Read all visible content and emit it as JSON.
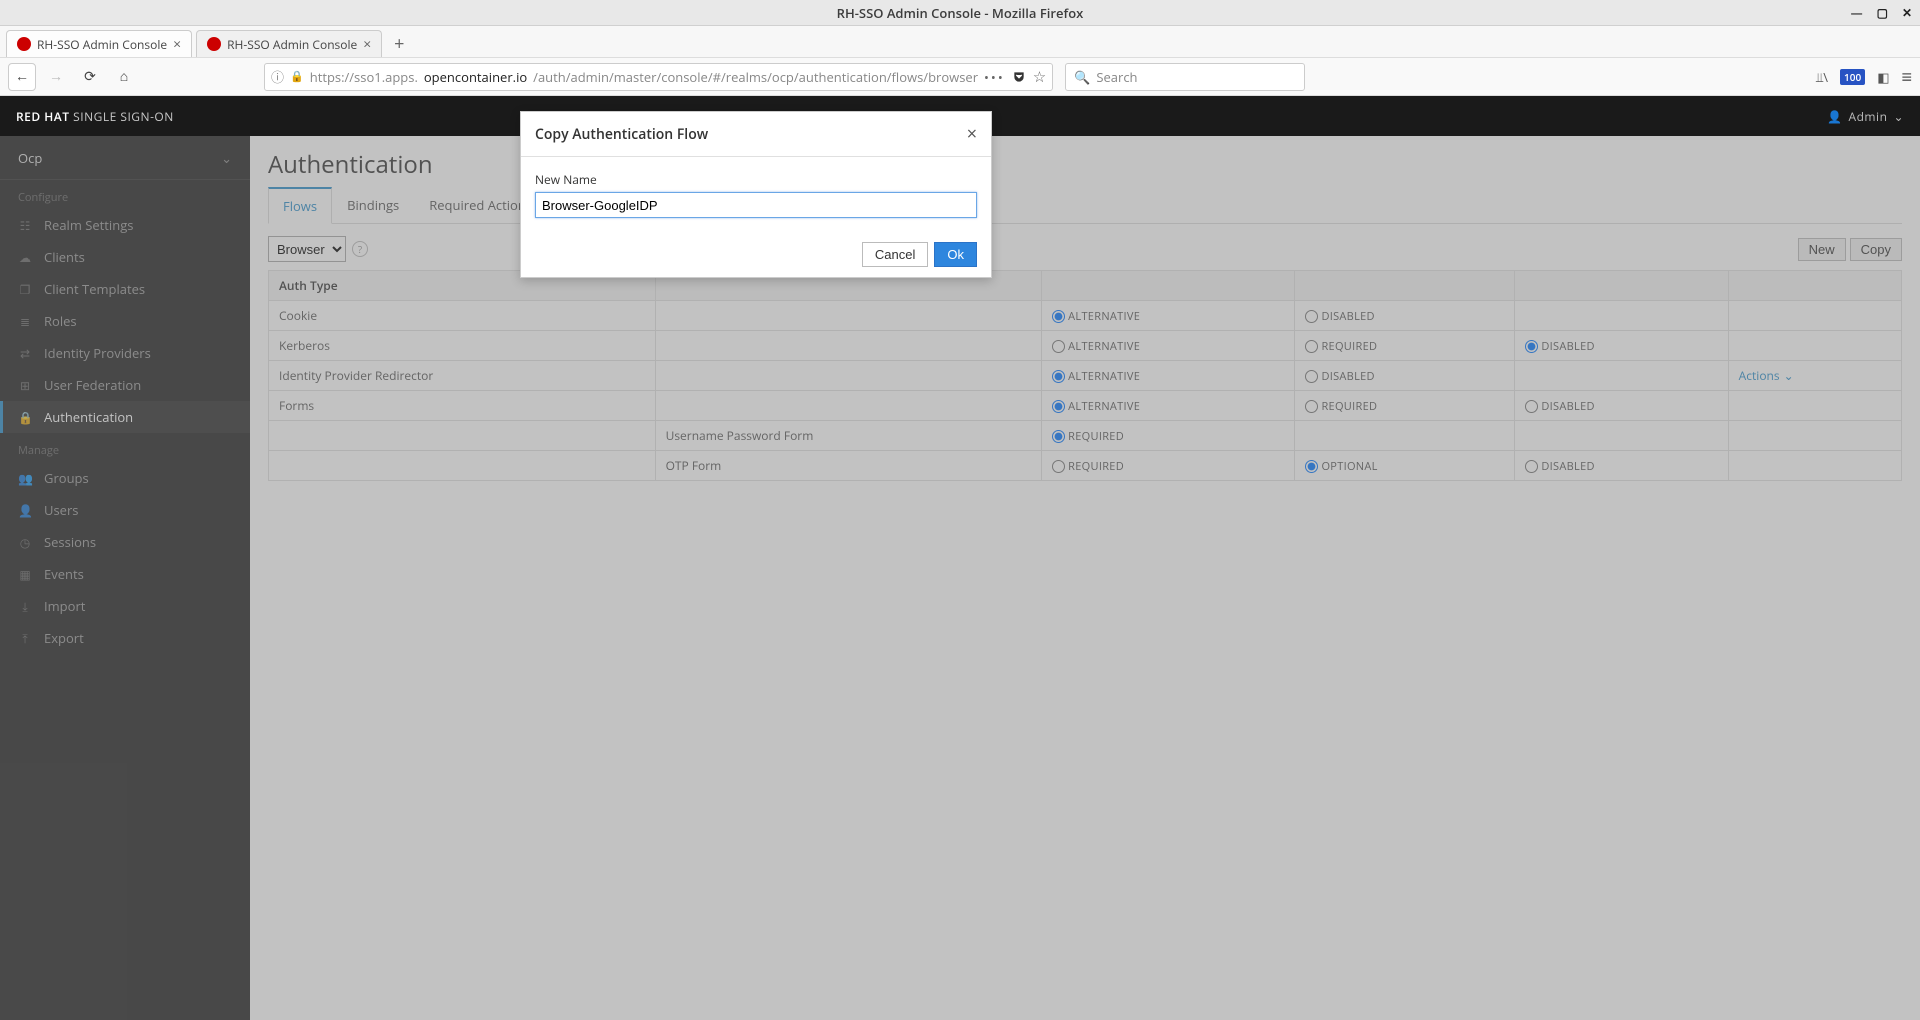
{
  "os": {
    "window_title": "RH-SSO Admin Console - Mozilla Firefox"
  },
  "browser": {
    "tabs": [
      {
        "label": "RH-SSO Admin Console"
      },
      {
        "label": "RH-SSO Admin Console"
      }
    ],
    "url_prefix": "https://sso1.apps.",
    "url_domain": "opencontainer.io",
    "url_path": "/auth/admin/master/console/#/realms/ocp/authentication/flows/browser",
    "search_placeholder": "Search",
    "badge": "100"
  },
  "header": {
    "brand_bold": "RED HAT",
    "brand_rest": " SINGLE SIGN-ON",
    "admin_label": "Admin"
  },
  "sidebar": {
    "realm": "Ocp",
    "section_configure": "Configure",
    "section_manage": "Manage",
    "configure_items": [
      "Realm Settings",
      "Clients",
      "Client Templates",
      "Roles",
      "Identity Providers",
      "User Federation",
      "Authentication"
    ],
    "manage_items": [
      "Groups",
      "Users",
      "Sessions",
      "Events",
      "Import",
      "Export"
    ]
  },
  "page": {
    "title": "Authentication",
    "tabs": [
      "Flows",
      "Bindings",
      "Required Actions"
    ],
    "flow_select": "Browser",
    "btn_new": "New",
    "btn_copy": "Copy",
    "col_authtype": "Auth Type",
    "actions_label": "Actions",
    "req_alt": "ALTERNATIVE",
    "req_req": "REQUIRED",
    "req_dis": "DISABLED",
    "req_opt": "OPTIONAL",
    "rows": [
      {
        "name": "Cookie",
        "indent": 0,
        "sel": "ALTERNATIVE",
        "opts": [
          "ALTERNATIVE",
          "DISABLED"
        ],
        "actions": false
      },
      {
        "name": "Kerberos",
        "indent": 0,
        "sel": "DISABLED",
        "opts": [
          "ALTERNATIVE",
          "REQUIRED",
          "DISABLED"
        ],
        "actions": false
      },
      {
        "name": "Identity Provider Redirector",
        "indent": 0,
        "sel": "ALTERNATIVE",
        "opts": [
          "ALTERNATIVE",
          "DISABLED"
        ],
        "actions": true
      },
      {
        "name": "Forms",
        "indent": 0,
        "sel": "ALTERNATIVE",
        "opts": [
          "ALTERNATIVE",
          "REQUIRED",
          "DISABLED"
        ],
        "actions": false
      },
      {
        "name": "Username Password Form",
        "indent": 1,
        "sel": "REQUIRED",
        "opts": [
          "REQUIRED"
        ],
        "actions": false
      },
      {
        "name": "OTP Form",
        "indent": 1,
        "sel": "OPTIONAL",
        "opts": [
          "REQUIRED",
          "OPTIONAL",
          "DISABLED"
        ],
        "actions": false
      }
    ]
  },
  "modal": {
    "title": "Copy Authentication Flow",
    "label": "New Name",
    "value": "Browser-GoogleIDP",
    "cancel": "Cancel",
    "ok": "Ok"
  }
}
